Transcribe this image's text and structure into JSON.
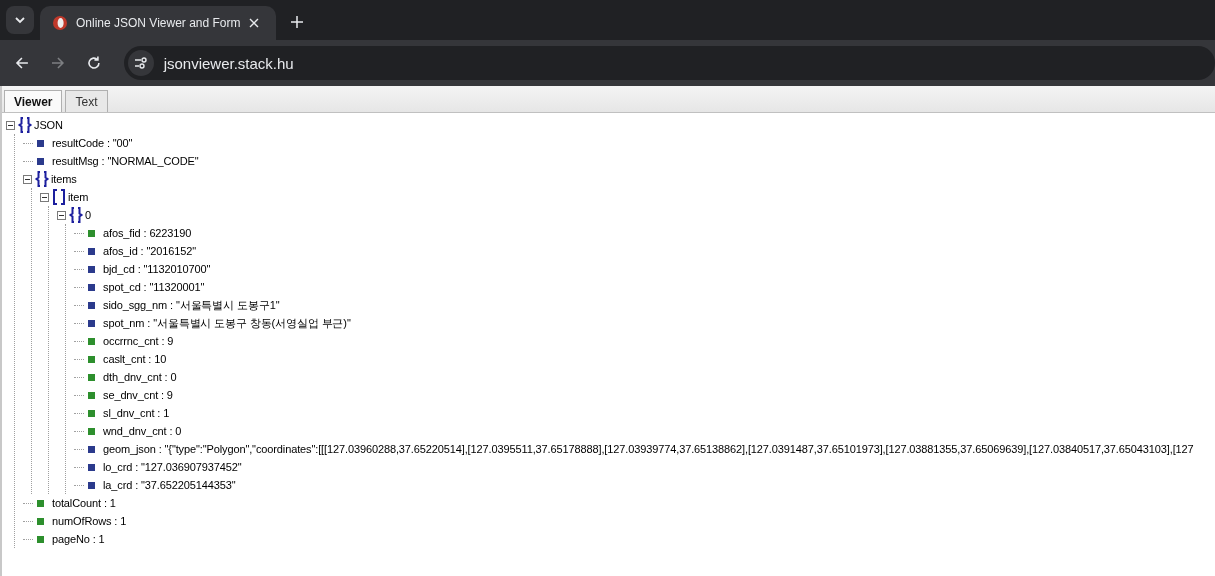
{
  "browser": {
    "tab_title": "Online JSON Viewer and Form",
    "url": "jsonviewer.stack.hu"
  },
  "view_tabs": [
    {
      "label": "Viewer",
      "selected": true
    },
    {
      "label": "Text",
      "selected": false
    }
  ],
  "tree": [
    {
      "kind": "object",
      "text": "JSON",
      "expanded": true,
      "children": [
        {
          "kind": "string",
          "text": "resultCode : \"00\""
        },
        {
          "kind": "string",
          "text": "resultMsg : \"NORMAL_CODE\""
        },
        {
          "kind": "object",
          "text": "items",
          "expanded": true,
          "children": [
            {
              "kind": "array",
              "text": "item",
              "expanded": true,
              "children": [
                {
                  "kind": "object",
                  "text": "0",
                  "expanded": true,
                  "children": [
                    {
                      "kind": "number",
                      "text": "afos_fid : 6223190"
                    },
                    {
                      "kind": "string",
                      "text": "afos_id : \"2016152\""
                    },
                    {
                      "kind": "string",
                      "text": "bjd_cd : \"1132010700\""
                    },
                    {
                      "kind": "string",
                      "text": "spot_cd : \"11320001\""
                    },
                    {
                      "kind": "string",
                      "text": "sido_sgg_nm : \"서울특별시 도봉구1\""
                    },
                    {
                      "kind": "string",
                      "text": "spot_nm : \"서울특별시 도봉구 창동(서영실업 부근)\""
                    },
                    {
                      "kind": "number",
                      "text": "occrrnc_cnt : 9"
                    },
                    {
                      "kind": "number",
                      "text": "caslt_cnt : 10"
                    },
                    {
                      "kind": "number",
                      "text": "dth_dnv_cnt : 0"
                    },
                    {
                      "kind": "number",
                      "text": "se_dnv_cnt : 9"
                    },
                    {
                      "kind": "number",
                      "text": "sl_dnv_cnt : 1"
                    },
                    {
                      "kind": "number",
                      "text": "wnd_dnv_cnt : 0"
                    },
                    {
                      "kind": "string",
                      "text": "geom_json : \"{\"type\":\"Polygon\",\"coordinates\":[[[127.03960288,37.65220514],[127.0395511,37.65178888],[127.03939774,37.65138862],[127.0391487,37.65101973],[127.03881355,37.65069639],[127.03840517,37.65043103],[127"
                    },
                    {
                      "kind": "string",
                      "text": "lo_crd : \"127.036907937452\""
                    },
                    {
                      "kind": "string",
                      "text": "la_crd : \"37.652205144353\""
                    }
                  ]
                }
              ]
            }
          ]
        },
        {
          "kind": "number",
          "text": "totalCount : 1"
        },
        {
          "kind": "number",
          "text": "numOfRows : 1"
        },
        {
          "kind": "number",
          "text": "pageNo : 1"
        }
      ]
    }
  ]
}
